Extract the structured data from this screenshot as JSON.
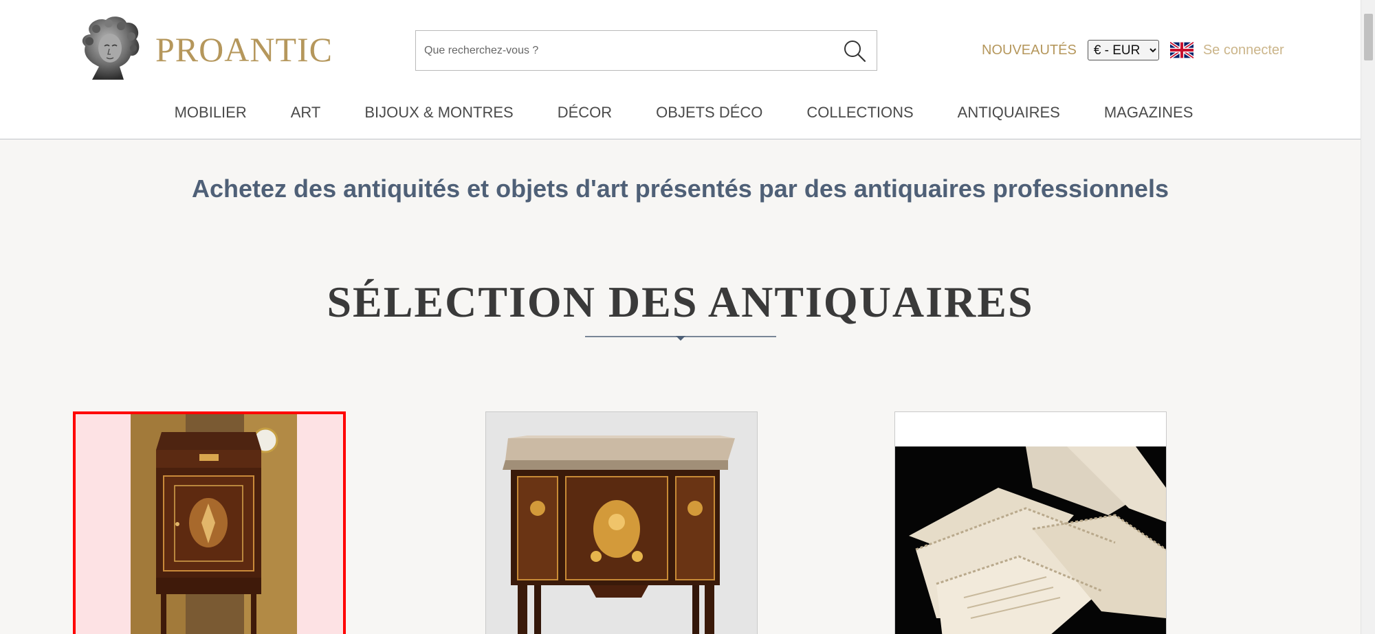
{
  "header": {
    "logo_text": "PROANTIC",
    "search": {
      "placeholder": "Que recherchez-vous ?",
      "value": ""
    },
    "nouveautes_label": "NOUVEAUTÉS",
    "currency": {
      "selected": "€ - EUR"
    },
    "language_icon": "uk-flag-icon",
    "login_label": "Se connecter"
  },
  "nav": {
    "items": [
      {
        "label": "MOBILIER"
      },
      {
        "label": "ART"
      },
      {
        "label": "BIJOUX & MONTRES"
      },
      {
        "label": "DÉCOR"
      },
      {
        "label": "OBJETS DÉCO"
      },
      {
        "label": "COLLECTIONS"
      },
      {
        "label": "ANTIQUAIRES"
      },
      {
        "label": "MAGAZINES"
      }
    ]
  },
  "main": {
    "tagline": "Achetez des antiquités et objets d'art présentés par des antiquaires professionnels",
    "section_title": "SÉLECTION DES ANTIQUAIRES"
  },
  "colors": {
    "brand_gold": "#b5975c",
    "login_gold": "#cbb58a",
    "tagline_blue": "#4f6077",
    "highlight_red": "#ff0000"
  }
}
